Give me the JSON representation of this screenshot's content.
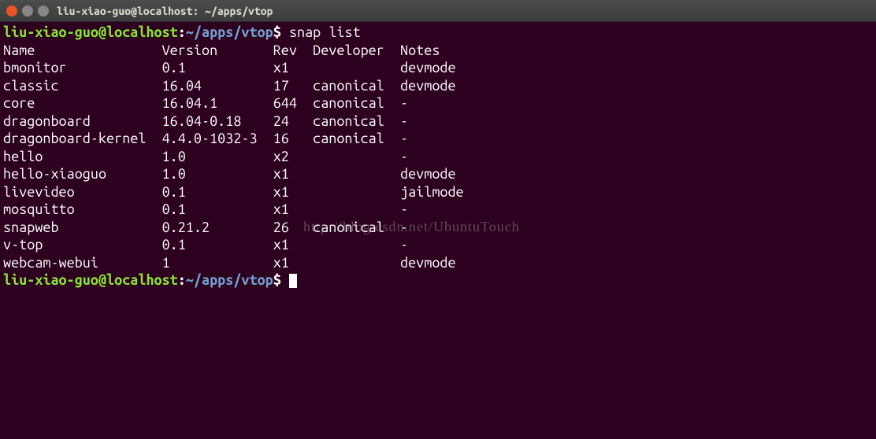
{
  "window": {
    "title": "liu-xiao-guo@localhost: ~/apps/vtop"
  },
  "prompt": {
    "user_host": "liu-xiao-guo@localhost",
    "colon": ":",
    "path": "~/apps/vtop",
    "symbol": "$"
  },
  "command": "snap list",
  "headers": {
    "name": "Name",
    "version": "Version",
    "rev": "Rev",
    "developer": "Developer",
    "notes": "Notes"
  },
  "rows": [
    {
      "name": "bmonitor",
      "version": "0.1",
      "rev": "x1",
      "developer": "",
      "notes": "devmode"
    },
    {
      "name": "classic",
      "version": "16.04",
      "rev": "17",
      "developer": "canonical",
      "notes": "devmode"
    },
    {
      "name": "core",
      "version": "16.04.1",
      "rev": "644",
      "developer": "canonical",
      "notes": "-"
    },
    {
      "name": "dragonboard",
      "version": "16.04-0.18",
      "rev": "24",
      "developer": "canonical",
      "notes": "-"
    },
    {
      "name": "dragonboard-kernel",
      "version": "4.4.0-1032-3",
      "rev": "16",
      "developer": "canonical",
      "notes": "-"
    },
    {
      "name": "hello",
      "version": "1.0",
      "rev": "x2",
      "developer": "",
      "notes": "-"
    },
    {
      "name": "hello-xiaoguo",
      "version": "1.0",
      "rev": "x1",
      "developer": "",
      "notes": "devmode"
    },
    {
      "name": "livevideo",
      "version": "0.1",
      "rev": "x1",
      "developer": "",
      "notes": "jailmode"
    },
    {
      "name": "mosquitto",
      "version": "0.1",
      "rev": "x1",
      "developer": "",
      "notes": "-"
    },
    {
      "name": "snapweb",
      "version": "0.21.2",
      "rev": "26",
      "developer": "canonical",
      "notes": "-"
    },
    {
      "name": "v-top",
      "version": "0.1",
      "rev": "x1",
      "developer": "",
      "notes": "-"
    },
    {
      "name": "webcam-webui",
      "version": "1",
      "rev": "x1",
      "developer": "",
      "notes": "devmode"
    }
  ],
  "watermark": "http://blog.csdn.net/UbuntuTouch",
  "col_widths": {
    "name": 20,
    "version": 14,
    "rev": 5,
    "developer": 11,
    "notes": 8
  }
}
